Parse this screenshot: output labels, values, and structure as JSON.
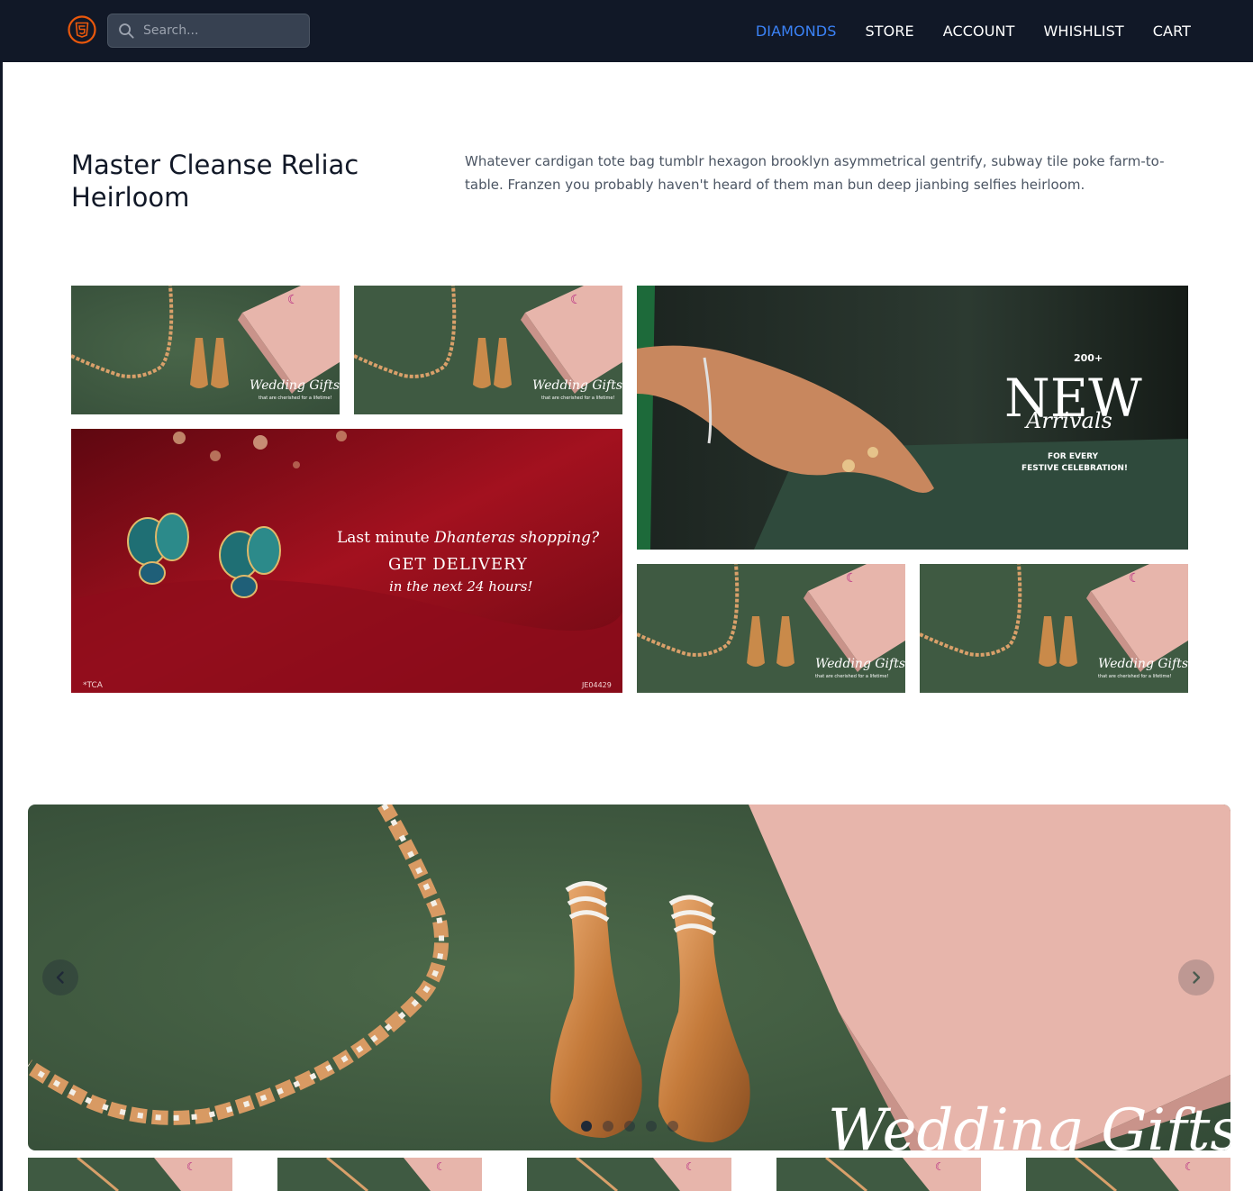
{
  "navbar": {
    "logo_icon": "html5-logo-icon",
    "search_placeholder": "Search...",
    "links": [
      "DIAMONDS",
      "STORE",
      "ACCOUNT",
      "WHISHLIST",
      "CART"
    ],
    "active_link": "DIAMONDS",
    "active_color": "#3b82f6"
  },
  "hero": {
    "title": "Master Cleanse Reliac Heirloom",
    "description": "Whatever cardigan tote bag tumblr hexagon brooklyn asymmetrical gentrify, subway tile poke farm-to-table. Franzen you probably haven't heard of them man bun deep jianbing selfies heirloom."
  },
  "gallery": {
    "wedding_script": "Wedding Gifts",
    "wedding_sub": "that are cherished for a lifetime!",
    "dhanteras_line1": "Last minute",
    "dhanteras_line1_em": "Dhanteras shopping?",
    "dhanteras_line2": "GET DELIVERY",
    "dhanteras_line3": "in the next 24 hours!",
    "dhanteras_note": "*TCA",
    "dhanteras_code": "JE04429",
    "arrivals_count": "200+",
    "arrivals_new": "NEW",
    "arrivals_script": "Arrivals",
    "arrivals_line1": "FOR EVERY",
    "arrivals_line2": "FESTIVE CELEBRATION!"
  },
  "carousel": {
    "slide_caption": "Wedding Gifts",
    "prev_icon": "chevron-left-icon",
    "next_icon": "chevron-right-icon",
    "slide_count": 5,
    "active_slide": 1
  },
  "colors": {
    "navbar_bg": "#111827",
    "velvet_green": "#3a5a40",
    "box_pink": "#e7b5ab",
    "velvet_red": "#8f0d1b",
    "gold": "#c98a4a"
  }
}
